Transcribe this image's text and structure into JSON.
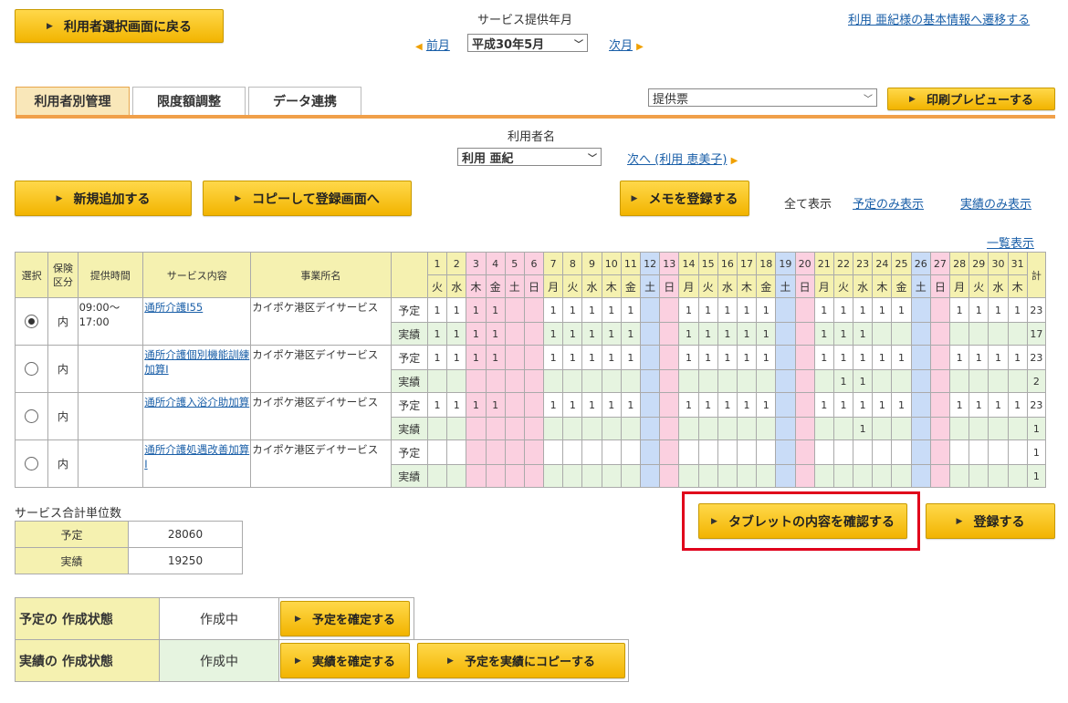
{
  "header": {
    "back_button": "利用者選択画面に戻る",
    "service_month_label": "サービス提供年月",
    "prev_month": "前月",
    "month_select": "平成30年5月",
    "next_month": "次月",
    "basic_info_link": "利用 亜紀様の基本情報へ遷移する"
  },
  "tabs": [
    {
      "label": "利用者別管理",
      "active": true
    },
    {
      "label": "限度額調整",
      "active": false
    },
    {
      "label": "データ連携",
      "active": false
    }
  ],
  "print": {
    "select_value": "提供票",
    "preview_button": "印刷プレビューする"
  },
  "user": {
    "label": "利用者名",
    "select_value": "利用 亜紀",
    "next_link": "次へ (利用 恵美子)"
  },
  "actions": {
    "add_button": "新規追加する",
    "copy_button": "コピーして登録画面へ",
    "memo_button": "メモを登録する",
    "show_all": "全て表示",
    "show_plan": "予定のみ表示",
    "show_actual": "実績のみ表示",
    "list_view": "一覧表示"
  },
  "grid": {
    "headers": {
      "select": "選択",
      "insurance": "保険区分",
      "time": "提供時間",
      "service": "サービス内容",
      "office": "事業所名",
      "total": "計"
    },
    "days": [
      "1",
      "2",
      "3",
      "4",
      "5",
      "6",
      "7",
      "8",
      "9",
      "10",
      "11",
      "12",
      "13",
      "14",
      "15",
      "16",
      "17",
      "18",
      "19",
      "20",
      "21",
      "22",
      "23",
      "24",
      "25",
      "26",
      "27",
      "28",
      "29",
      "30",
      "31"
    ],
    "weekdays": [
      "火",
      "水",
      "木",
      "金",
      "土",
      "日",
      "月",
      "火",
      "水",
      "木",
      "金",
      "土",
      "日",
      "月",
      "火",
      "水",
      "木",
      "金",
      "土",
      "日",
      "月",
      "火",
      "水",
      "木",
      "金",
      "土",
      "日",
      "月",
      "火",
      "水",
      "木"
    ],
    "day_types": [
      "w",
      "w",
      "h",
      "h",
      "h",
      "h",
      "w",
      "w",
      "w",
      "w",
      "w",
      "sat",
      "sun",
      "w",
      "w",
      "w",
      "w",
      "w",
      "sat",
      "sun",
      "w",
      "w",
      "w",
      "w",
      "w",
      "sat",
      "sun",
      "w",
      "w",
      "w",
      "w"
    ],
    "plan_label": "予定",
    "actual_label": "実績",
    "rows": [
      {
        "selected": true,
        "insurance": "内",
        "time": "09:00～17:00",
        "service": "通所介護Ⅰ55",
        "office": "カイポケ港区デイサービス",
        "plan": [
          "1",
          "1",
          "1",
          "1",
          "",
          "",
          "1",
          "1",
          "1",
          "1",
          "1",
          "",
          "",
          "1",
          "1",
          "1",
          "1",
          "1",
          "",
          "",
          "1",
          "1",
          "1",
          "1",
          "1",
          "",
          "",
          "1",
          "1",
          "1",
          "1"
        ],
        "plan_total": "23",
        "actual": [
          "1",
          "1",
          "1",
          "1",
          "",
          "",
          "1",
          "1",
          "1",
          "1",
          "1",
          "",
          "",
          "1",
          "1",
          "1",
          "1",
          "1",
          "",
          "",
          "1",
          "1",
          "1",
          "",
          "",
          "",
          "",
          "",
          "",
          "",
          ""
        ],
        "actual_total": "17"
      },
      {
        "selected": false,
        "insurance": "内",
        "time": "",
        "service": "通所介護個別機能訓練加算Ⅰ",
        "office": "カイポケ港区デイサービス",
        "plan": [
          "1",
          "1",
          "1",
          "1",
          "",
          "",
          "1",
          "1",
          "1",
          "1",
          "1",
          "",
          "",
          "1",
          "1",
          "1",
          "1",
          "1",
          "",
          "",
          "1",
          "1",
          "1",
          "1",
          "1",
          "",
          "",
          "1",
          "1",
          "1",
          "1"
        ],
        "plan_total": "23",
        "actual": [
          "",
          "",
          "",
          "",
          "",
          "",
          "",
          "",
          "",
          "",
          "",
          "",
          "",
          "",
          "",
          "",
          "",
          "",
          "",
          "",
          "",
          "1",
          "1",
          "",
          "",
          "",
          "",
          "",
          "",
          "",
          ""
        ],
        "actual_total": "2"
      },
      {
        "selected": false,
        "insurance": "内",
        "time": "",
        "service": "通所介護入浴介助加算",
        "office": "カイポケ港区デイサービス",
        "plan": [
          "1",
          "1",
          "1",
          "1",
          "",
          "",
          "1",
          "1",
          "1",
          "1",
          "1",
          "",
          "",
          "1",
          "1",
          "1",
          "1",
          "1",
          "",
          "",
          "1",
          "1",
          "1",
          "1",
          "1",
          "",
          "",
          "1",
          "1",
          "1",
          "1"
        ],
        "plan_total": "23",
        "actual": [
          "",
          "",
          "",
          "",
          "",
          "",
          "",
          "",
          "",
          "",
          "",
          "",
          "",
          "",
          "",
          "",
          "",
          "",
          "",
          "",
          "",
          "",
          "1",
          "",
          "",
          "",
          "",
          "",
          "",
          "",
          ""
        ],
        "actual_total": "1"
      },
      {
        "selected": false,
        "insurance": "内",
        "time": "",
        "service": "通所介護処遇改善加算Ⅰ",
        "office": "カイポケ港区デイサービス",
        "plan": [
          "",
          "",
          "",
          "",
          "",
          "",
          "",
          "",
          "",
          "",
          "",
          "",
          "",
          "",
          "",
          "",
          "",
          "",
          "",
          "",
          "",
          "",
          "",
          "",
          "",
          "",
          "",
          "",
          "",
          "",
          ""
        ],
        "plan_total": "1",
        "actual": [
          "",
          "",
          "",
          "",
          "",
          "",
          "",
          "",
          "",
          "",
          "",
          "",
          "",
          "",
          "",
          "",
          "",
          "",
          "",
          "",
          "",
          "",
          "",
          "",
          "",
          "",
          "",
          "",
          "",
          "",
          ""
        ],
        "actual_total": "1"
      }
    ]
  },
  "summary": {
    "title": "サービス合計単位数",
    "plan_label": "予定",
    "plan_value": "28060",
    "actual_label": "実績",
    "actual_value": "19250"
  },
  "tablet_button": "タブレットの内容を確認する",
  "register_button": "登録する",
  "status": {
    "plan_label": "予定の 作成状態",
    "plan_state": "作成中",
    "plan_confirm": "予定を確定する",
    "actual_label": "実績の 作成状態",
    "actual_state": "作成中",
    "actual_confirm": "実績を確定する",
    "copy_plan_to_actual": "予定を実績にコピーする"
  },
  "colors": {
    "button": "#f2b400",
    "saturday": "#c9dcf7",
    "sunday": "#fbd0e0",
    "actual_row": "#e6f4e0",
    "header": "#f5f1b0",
    "highlight": "#e0001b"
  }
}
